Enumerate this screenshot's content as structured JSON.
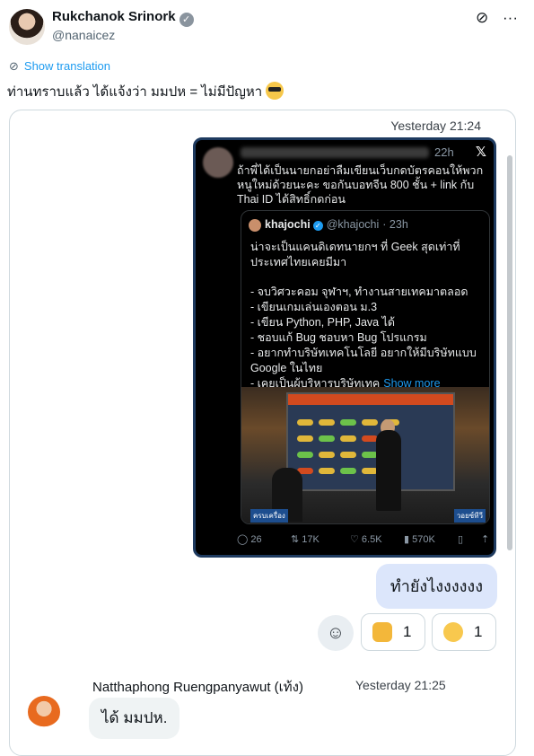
{
  "author": {
    "name": "Rukchanok Srinork",
    "handle": "@nanaicez"
  },
  "show_translation": "Show translation",
  "tweet_text": "ท่านทราบแล้ว ได้แจ้งว่า มมปห = ไม่มีปัญหา",
  "chat": {
    "timestamp_top": "Yesterday 21:24",
    "screenshot": {
      "time": "22h",
      "text": "ถ้าพี่ได้เป็นนายกอย่าลืมเขียนเว็บกดบัตรคอนให้พวกหนูใหม่ด้วยนะคะ ขอกันบอทจีน 800 ชั้น + link กับ Thai ID ได้สิทธิ์กดก่อน",
      "quote": {
        "name": "khajochi",
        "handle": "@khajochi",
        "time": "· 23h",
        "lines": [
          "น่าจะเป็นแคนดิเดทนายกฯ ที่ Geek สุดเท่าที่",
          "ประเทศไทยเคยมีมา",
          "",
          "- จบวิศวะคอม จุฬาฯ, ทำงานสายเทคมาตลอด",
          "- เขียนเกมเล่นเองตอน ม.3",
          "- เขียน Python, PHP, Java ได้",
          "- ชอบแก้ Bug ชอบหา Bug โปรแกรม",
          "- อยากทำบริษัทเทคโนโลยี อยากให้มีบริษัทแบบ",
          "Google ในไทย",
          "- เคยเป็นผู้บริหารบริษัทเทค"
        ],
        "show_more": "Show more",
        "image_label_left": "ครบเครื่อง",
        "image_label_right": "วอยซ์ทีวี"
      },
      "stats": {
        "replies": "26",
        "retweets": "17K",
        "likes": "6.5K",
        "views": "570K"
      }
    },
    "outgoing_message": "ทำยังไงงงงงง",
    "reactions": [
      {
        "emoji": "thumbs-up",
        "count": "1"
      },
      {
        "emoji": "sweat-smile",
        "count": "1"
      }
    ],
    "incoming": {
      "sender": "Natthaphong Ruengpanyawut (เท้ง)",
      "time": "Yesterday 21:25",
      "message": "ได้ มมปห."
    }
  }
}
